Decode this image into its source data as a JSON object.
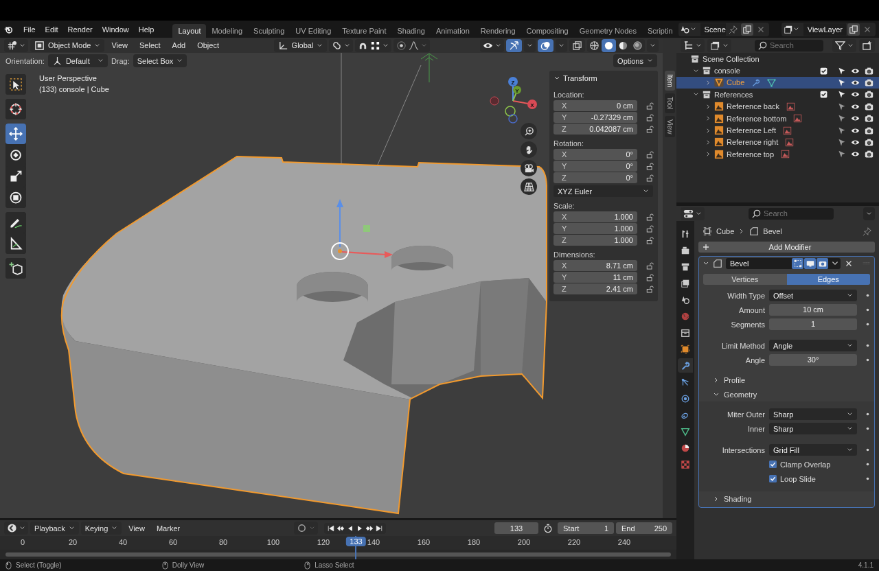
{
  "topbar": {
    "menus": [
      "File",
      "Edit",
      "Render",
      "Window",
      "Help"
    ],
    "workspaces": [
      {
        "label": "Layout",
        "selected": true
      },
      {
        "label": "Modeling",
        "selected": false
      },
      {
        "label": "Sculpting",
        "selected": false
      },
      {
        "label": "UV Editing",
        "selected": false
      },
      {
        "label": "Texture Paint",
        "selected": false
      },
      {
        "label": "Shading",
        "selected": false
      },
      {
        "label": "Animation",
        "selected": false
      },
      {
        "label": "Rendering",
        "selected": false
      },
      {
        "label": "Compositing",
        "selected": false
      },
      {
        "label": "Geometry Nodes",
        "selected": false
      },
      {
        "label": "Scriptin",
        "selected": false
      }
    ],
    "scene": "Scene",
    "view_layer": "ViewLayer"
  },
  "viewport": {
    "mode": "Object Mode",
    "menus": [
      "View",
      "Select",
      "Add",
      "Object"
    ],
    "orientation": "Global",
    "snap_on": false,
    "proportional_on": false,
    "gizmos_on": true,
    "overlays_on": true,
    "shading": [
      {
        "kind": "wireframe",
        "selected": false
      },
      {
        "kind": "solid",
        "selected": true
      },
      {
        "kind": "material",
        "selected": false
      },
      {
        "kind": "rendered",
        "selected": false
      }
    ],
    "tool_settings": {
      "orientation_label": "Orientation:",
      "orientation": "Default",
      "drag_label": "Drag:",
      "drag": "Select Box",
      "options": "Options"
    },
    "info": [
      "User Perspective",
      "(133) console | Cube"
    ],
    "tools": [
      [
        {
          "kind": "select",
          "selected": false
        }
      ],
      [
        {
          "kind": "cursor",
          "selected": false
        }
      ],
      [
        {
          "kind": "move",
          "selected": true
        },
        {
          "kind": "rotate",
          "selected": false
        },
        {
          "kind": "scale",
          "selected": false
        },
        {
          "kind": "transform",
          "selected": false
        }
      ],
      [
        {
          "kind": "annotate",
          "selected": false
        },
        {
          "kind": "measure",
          "selected": false
        }
      ],
      [
        {
          "kind": "add-cube",
          "selected": false
        }
      ]
    ],
    "axes": [
      "Z",
      "Y",
      "X"
    ],
    "sidebar_tabs": [
      {
        "label": "Item",
        "selected": true
      },
      {
        "label": "Tool",
        "selected": false
      },
      {
        "label": "View",
        "selected": false
      }
    ],
    "transform": {
      "title": "Transform",
      "groups": [
        {
          "label": "Location:",
          "fields": [
            {
              "axis": "X",
              "value": "0 cm"
            },
            {
              "axis": "Y",
              "value": "-0.27329 cm"
            },
            {
              "axis": "Z",
              "value": "0.042087 cm"
            }
          ]
        },
        {
          "label": "Rotation:",
          "fields": [
            {
              "axis": "X",
              "value": "0°"
            },
            {
              "axis": "Y",
              "value": "0°"
            },
            {
              "axis": "Z",
              "value": "0°"
            }
          ],
          "mode": "XYZ Euler"
        },
        {
          "label": "Scale:",
          "fields": [
            {
              "axis": "X",
              "value": "1.000"
            },
            {
              "axis": "Y",
              "value": "1.000"
            },
            {
              "axis": "Z",
              "value": "1.000"
            }
          ]
        },
        {
          "label": "Dimensions:",
          "fields": [
            {
              "axis": "X",
              "value": "8.71 cm"
            },
            {
              "axis": "Y",
              "value": "11 cm"
            },
            {
              "axis": "Z",
              "value": "2.41 cm"
            }
          ]
        }
      ]
    }
  },
  "outliner": {
    "search_placeholder": "Search",
    "root": {
      "label": "Scene Collection",
      "children": [
        {
          "label": "console",
          "kind": "collection",
          "expanded": true,
          "checked": true,
          "selected": false,
          "children": [
            {
              "label": "Cube",
              "kind": "mesh",
              "expanded": false,
              "selected": true
            }
          ]
        },
        {
          "label": "References",
          "kind": "collection",
          "expanded": true,
          "checked": true,
          "selected": false,
          "children": [
            {
              "label": "Reference back",
              "kind": "image",
              "expanded": false,
              "selected": false
            },
            {
              "label": "Reference bottom",
              "kind": "image",
              "expanded": false,
              "selected": false
            },
            {
              "label": "Reference Left",
              "kind": "image",
              "expanded": false,
              "selected": false
            },
            {
              "label": "Reference right",
              "kind": "image",
              "expanded": false,
              "selected": false
            },
            {
              "label": "Reference top",
              "kind": "image",
              "expanded": false,
              "selected": false
            }
          ]
        }
      ]
    }
  },
  "properties": {
    "search_placeholder": "Search",
    "tabs": [
      {
        "kind": "tool",
        "selected": false
      },
      {
        "kind": "render",
        "selected": false
      },
      {
        "kind": "output",
        "selected": false
      },
      {
        "kind": "view-layer",
        "selected": false
      },
      {
        "kind": "scene",
        "selected": false
      },
      {
        "kind": "world",
        "selected": false
      },
      {
        "kind": "collection",
        "selected": false
      },
      {
        "kind": "object",
        "selected": false
      },
      {
        "kind": "modifiers",
        "selected": true
      },
      {
        "kind": "particles",
        "selected": false
      },
      {
        "kind": "physics",
        "selected": false
      },
      {
        "kind": "constraints",
        "selected": false
      },
      {
        "kind": "data",
        "selected": false
      },
      {
        "kind": "material",
        "selected": false
      },
      {
        "kind": "texture",
        "selected": false
      }
    ],
    "breadcrumb": [
      "Cube",
      "Bevel"
    ],
    "add_modifier": "Add Modifier",
    "modifier": {
      "name": "Bevel",
      "expanded": true,
      "toggles": [
        {
          "kind": "edit-mode",
          "on": true
        },
        {
          "kind": "viewport",
          "on": true
        },
        {
          "kind": "render",
          "on": true
        }
      ],
      "affect": [
        {
          "label": "Vertices",
          "selected": false
        },
        {
          "label": "Edges",
          "selected": true
        }
      ],
      "groups": [
        [
          {
            "kind": "dropdown",
            "label": "Width Type",
            "value": "Offset"
          },
          {
            "kind": "number",
            "label": "Amount",
            "value": "10 cm"
          },
          {
            "kind": "number",
            "label": "Segments",
            "value": "1"
          }
        ],
        [
          {
            "kind": "dropdown",
            "label": "Limit Method",
            "value": "Angle"
          },
          {
            "kind": "number",
            "label": "Angle",
            "value": "30°"
          }
        ]
      ],
      "sections": [
        {
          "label": "Profile",
          "expanded": false
        },
        {
          "label": "Geometry",
          "expanded": true,
          "groups": [
            [
              {
                "kind": "dropdown",
                "label": "Miter Outer",
                "value": "Sharp"
              },
              {
                "kind": "dropdown",
                "label": "Inner",
                "value": "Sharp"
              }
            ],
            [
              {
                "kind": "dropdown",
                "label": "Intersections",
                "value": "Grid Fill"
              },
              {
                "kind": "checkbox",
                "label": "Clamp Overlap",
                "checked": true
              },
              {
                "kind": "checkbox",
                "label": "Loop Slide",
                "checked": true
              }
            ]
          ]
        },
        {
          "label": "Shading",
          "expanded": false
        }
      ]
    }
  },
  "timeline": {
    "menus": [
      "Playback",
      "Keying",
      "View",
      "Marker"
    ],
    "auto_keying_on": false,
    "current_frame": "133",
    "start_label": "Start",
    "start": "1",
    "end_label": "End",
    "end": "250",
    "ticks": [
      "0",
      "20",
      "40",
      "60",
      "80",
      "100",
      "120",
      "140",
      "160",
      "180",
      "200",
      "220",
      "240"
    ],
    "playhead": "133"
  },
  "status": {
    "hints": [
      "Select (Toggle)",
      "Dolly View",
      "Lasso Select"
    ],
    "version": "4.1.1"
  }
}
